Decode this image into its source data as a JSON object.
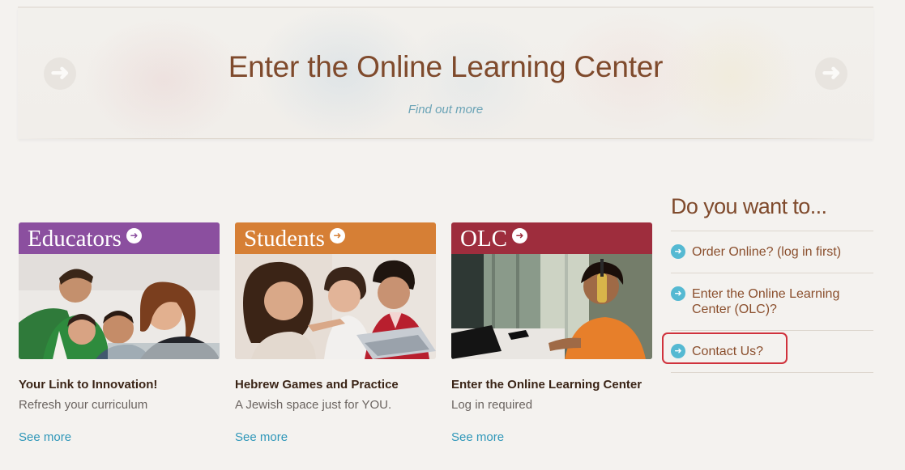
{
  "hero": {
    "title": "Enter the Online Learning Center",
    "link": "Find out more",
    "prev_icon": "arrow-left-icon",
    "next_icon": "arrow-right-icon"
  },
  "cards": [
    {
      "label": "Educators",
      "color": "#8b4f9f",
      "heading": "Your Link to Innovation!",
      "sub": "Refresh your curriculum",
      "more": "See more"
    },
    {
      "label": "Students",
      "color": "#d67f35",
      "heading": "Hebrew Games and Practice",
      "sub": "A Jewish space just for YOU.",
      "more": "See more"
    },
    {
      "label": "OLC",
      "color": "#9e2d3d",
      "heading": "Enter the Online Learning Center",
      "sub": "Log in required",
      "more": "See more"
    }
  ],
  "sidebar": {
    "title": "Do you want to...",
    "items": [
      {
        "label": "Order Online? (log in first)"
      },
      {
        "label": "Enter the Online Learning Center (OLC)?"
      },
      {
        "label": "Contact Us?"
      }
    ]
  },
  "colors": {
    "accent_brown": "#7f4a2c",
    "link_blue": "#2f97b9",
    "highlight_red": "#d0323c"
  }
}
